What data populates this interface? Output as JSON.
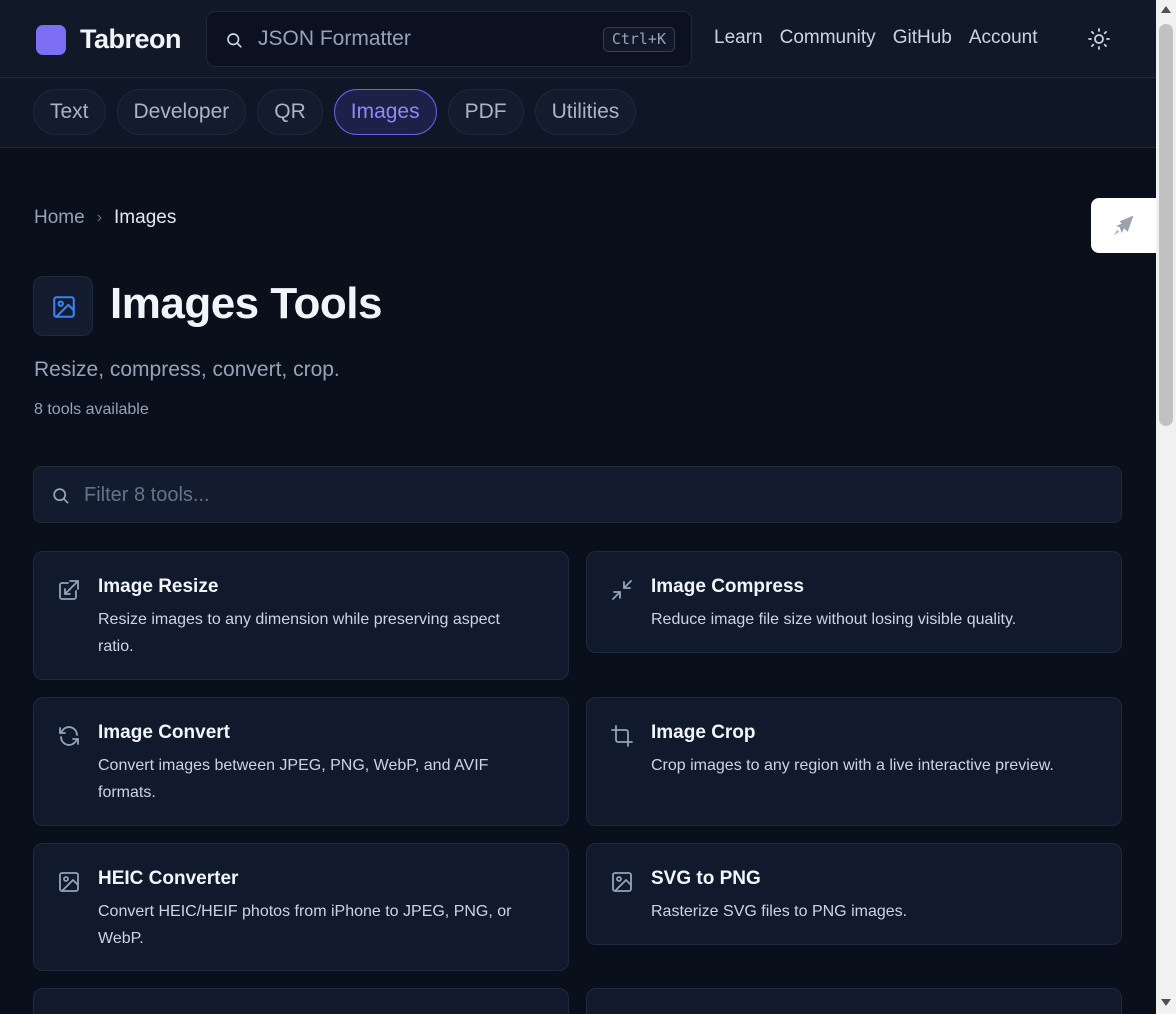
{
  "brand": {
    "name": "Tabreon",
    "accent": "#7c6ff5"
  },
  "search": {
    "placeholder": "JSON Formatter",
    "shortcut": "Ctrl+K"
  },
  "nav": {
    "items": [
      "Learn",
      "Community",
      "GitHub",
      "Account"
    ]
  },
  "categories": [
    {
      "label": "Text",
      "active": false
    },
    {
      "label": "Developer",
      "active": false
    },
    {
      "label": "QR",
      "active": false
    },
    {
      "label": "Images",
      "active": true
    },
    {
      "label": "PDF",
      "active": false
    },
    {
      "label": "Utilities",
      "active": false
    }
  ],
  "breadcrumb": {
    "home": "Home",
    "current": "Images"
  },
  "page": {
    "title": "Images Tools",
    "subtitle": "Resize, compress, convert, crop.",
    "count": "8 tools available",
    "icon": "image-icon"
  },
  "filter": {
    "placeholder": "Filter 8 tools..."
  },
  "tools": [
    {
      "title": "Image Resize",
      "desc": "Resize images to any dimension while preserving aspect ratio.",
      "icon": "resize-icon"
    },
    {
      "title": "Image Compress",
      "desc": "Reduce image file size without losing visible quality.",
      "icon": "compress-icon"
    },
    {
      "title": "Image Convert",
      "desc": "Convert images between JPEG, PNG, WebP, and AVIF formats.",
      "icon": "refresh-icon"
    },
    {
      "title": "Image Crop",
      "desc": "Crop images to any region with a live interactive preview.",
      "icon": "crop-icon"
    },
    {
      "title": "HEIC Converter",
      "desc": "Convert HEIC/HEIF photos from iPhone to JPEG, PNG, or WebP.",
      "icon": "image-icon"
    },
    {
      "title": "SVG to PNG",
      "desc": "Rasterize SVG files to PNG images.",
      "icon": "image-icon"
    }
  ]
}
